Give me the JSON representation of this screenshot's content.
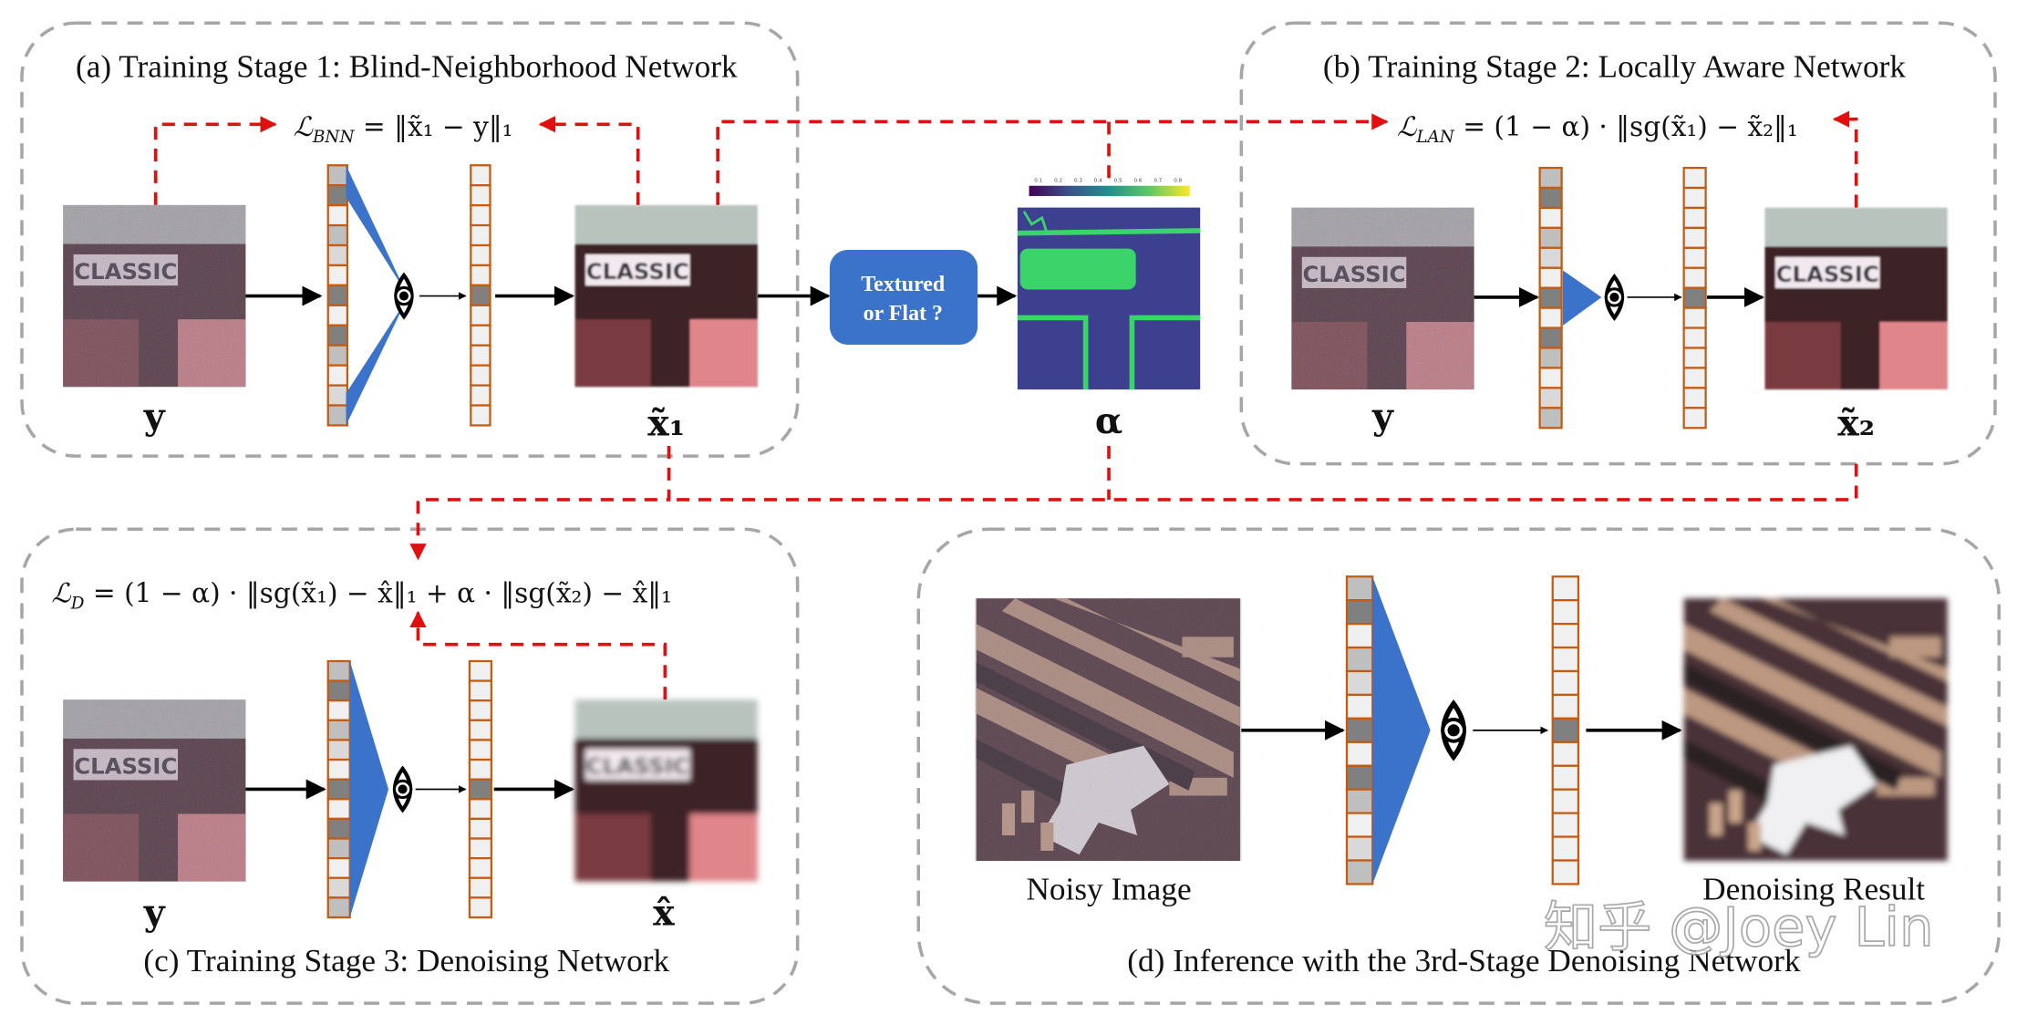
{
  "panels": {
    "a": {
      "caption": "(a) Training Stage 1: Blind-Neighborhood Network",
      "equation": "ℒ_BNN = ‖x̃₁ − y‖₁",
      "eq_main": "ℒ",
      "eq_sub": "BNN",
      "eq_rest": " = ‖x̃₁ − y‖₁",
      "input_label": "y",
      "output_label": "x̃₁"
    },
    "b": {
      "caption": "(b) Training Stage 2: Locally Aware Network",
      "eq_main": "ℒ",
      "eq_sub": "LAN",
      "eq_rest": " = (1 − α) · ‖sg(x̃₁) − x̃₂‖₁",
      "input_label": "y",
      "output_label": "x̃₂"
    },
    "c": {
      "caption": "(c) Training Stage 3: Denoising Network",
      "eq_main": "ℒ",
      "eq_sub": "D",
      "eq_rest": " = (1 − α) · ‖sg(x̃₁) − x̂‖₁ + α · ‖sg(x̃₂) − x̂‖₁",
      "input_label": "y",
      "output_label": "x̂"
    },
    "d": {
      "caption": "(d) Inference with the 3rd-Stage Denoising Network",
      "input_label": "Noisy Image",
      "output_label": "Denoising Result"
    }
  },
  "decision": {
    "line1": "Textured",
    "line2": "or Flat ?",
    "color": "#3a73c9"
  },
  "alpha": {
    "label": "α",
    "colorbar_ticks": [
      "0.1",
      "0.2",
      "0.3",
      "0.4",
      "0.5",
      "0.6",
      "0.7",
      "0.8"
    ]
  },
  "sign_text": "CLASSIC",
  "input_column_shades": [
    "#bfbfbf",
    "#808080",
    "#f0f0f0",
    "#bfbfbf",
    "#d9d9d9",
    "#f0f0f0",
    "#808080",
    "#f0f0f0",
    "#808080",
    "#bfbfbf",
    "#f0f0f0",
    "#d9d9d9",
    "#bfbfbf"
  ],
  "colors": {
    "column_border": "#c55a11",
    "cone": "#3a73c9",
    "loss_arrow": "#e01010",
    "panel_border": "#a6a6a6"
  },
  "watermark": "知乎 @Joey Lin"
}
